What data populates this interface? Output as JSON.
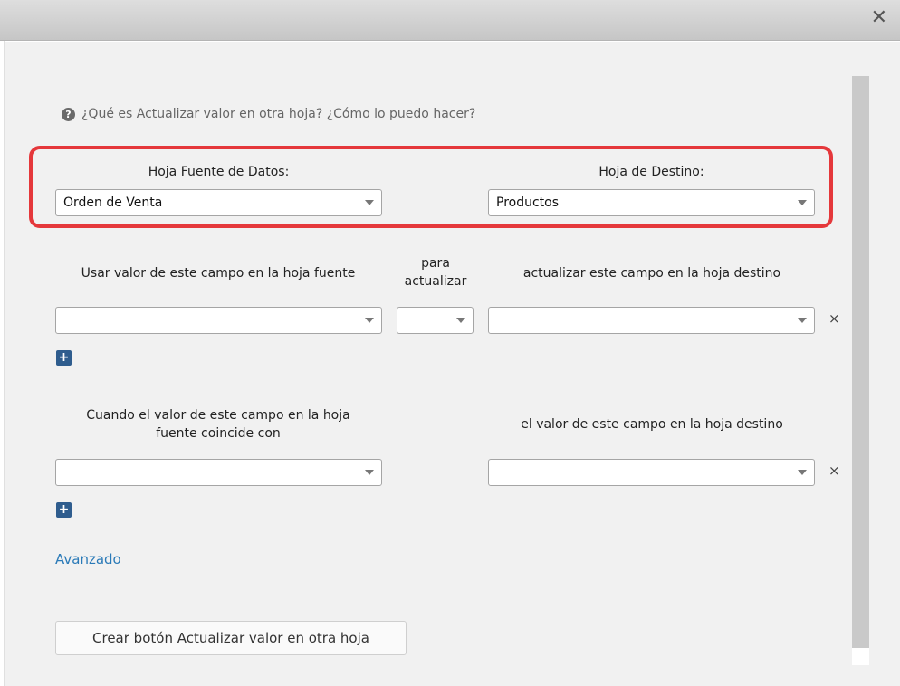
{
  "window": {
    "close_symbol": "✕"
  },
  "help": {
    "icon": "question-circle-icon",
    "text": "¿Qué es Actualizar valor en otra hoja? ¿Cómo lo puedo hacer?"
  },
  "sheets": {
    "source_label": "Hoja Fuente de Datos:",
    "source_value": "Orden de Venta",
    "target_label": "Hoja de Destino:",
    "target_value": "Productos"
  },
  "update_section": {
    "source_header": "Usar valor de este campo en la hoja fuente",
    "op_header_line1": "para",
    "op_header_line2": "actualizar",
    "target_header": "actualizar este campo en la hoja destino",
    "row": {
      "source_value": "",
      "op_value": "",
      "target_value": ""
    },
    "remove_symbol": "×",
    "add_symbol": "+"
  },
  "match_section": {
    "source_header_line1": "Cuando el valor de este campo en la hoja",
    "source_header_line2": "fuente coincide con",
    "target_header": "el valor de este campo en la hoja destino",
    "row": {
      "source_value": "",
      "target_value": ""
    },
    "remove_symbol": "×",
    "add_symbol": "+"
  },
  "advanced_link": "Avanzado",
  "create_button": "Crear botón Actualizar valor en otra hoja",
  "colors": {
    "highlight": "#e5383b",
    "link": "#2a7ab8",
    "plus_button": "#2f5d8e"
  }
}
